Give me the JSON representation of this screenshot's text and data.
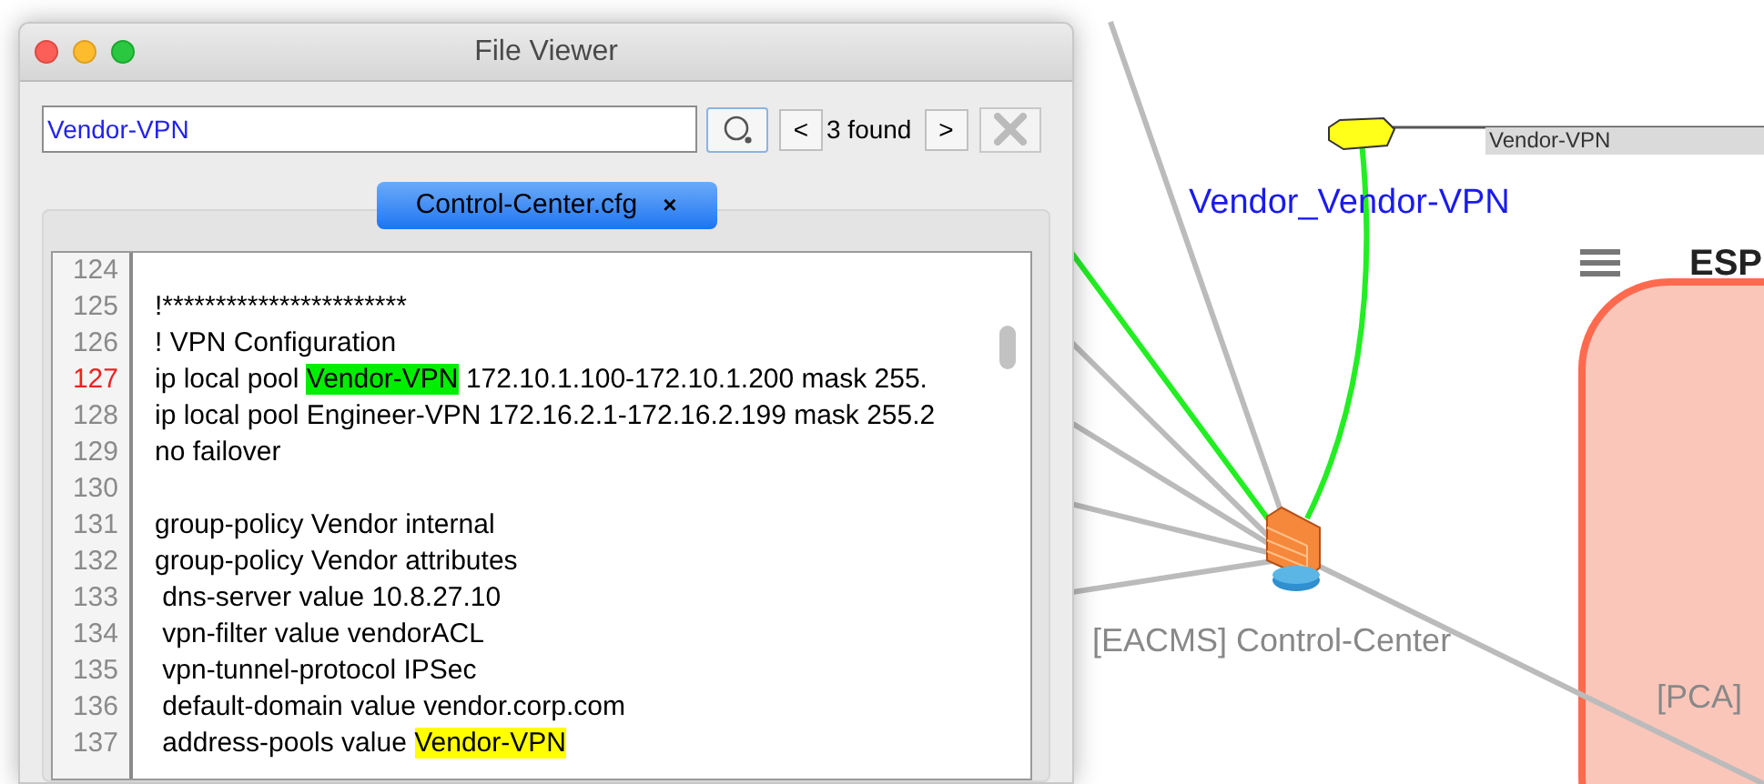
{
  "window": {
    "title": "File Viewer"
  },
  "search": {
    "value": "Vendor-VPN",
    "previous": "<",
    "result": "3 found",
    "next": ">"
  },
  "tabs": [
    {
      "label": "Control-Center.cfg",
      "close": "×",
      "selected": true
    }
  ],
  "editor": {
    "lines": [
      {
        "number": "124",
        "current": false
      },
      {
        "number": "125",
        "current": false,
        "parts": [
          {
            "text": "!***********************",
            "kind": "plain"
          }
        ]
      },
      {
        "number": "126",
        "current": false,
        "parts": [
          {
            "text": "! VPN Configuration",
            "kind": "plain"
          }
        ]
      },
      {
        "number": "127",
        "current": true,
        "parts": [
          {
            "text": "ip local pool ",
            "kind": "plain"
          },
          {
            "text": "Vendor-VPN",
            "kind": "current"
          },
          {
            "text": " 172.10.1.100-172.10.1.200 mask 255.",
            "kind": "plain"
          }
        ]
      },
      {
        "number": "128",
        "current": false,
        "parts": [
          {
            "text": "ip local pool Engineer-VPN 172.16.2.1-172.16.2.199 mask 255.2",
            "kind": "plain"
          }
        ]
      },
      {
        "number": "129",
        "current": false,
        "parts": [
          {
            "text": "no failover",
            "kind": "plain"
          }
        ]
      },
      {
        "number": "130",
        "current": false
      },
      {
        "number": "131",
        "current": false,
        "parts": [
          {
            "text": "group-policy Vendor internal",
            "kind": "plain"
          }
        ]
      },
      {
        "number": "132",
        "current": false,
        "parts": [
          {
            "text": "group-policy Vendor attributes",
            "kind": "plain"
          }
        ]
      },
      {
        "number": "133",
        "current": false,
        "parts": [
          {
            "text": " dns-server value 10.8.27.10",
            "kind": "plain"
          }
        ]
      },
      {
        "number": "134",
        "current": false,
        "parts": [
          {
            "text": " vpn-filter value vendorACL",
            "kind": "plain"
          }
        ]
      },
      {
        "number": "135",
        "current": false,
        "parts": [
          {
            "text": " vpn-tunnel-protocol IPSec",
            "kind": "plain"
          }
        ]
      },
      {
        "number": "136",
        "current": false,
        "parts": [
          {
            "text": " default-domain value vendor.corp.com",
            "kind": "plain"
          }
        ]
      },
      {
        "number": "137",
        "current": false,
        "parts": [
          {
            "text": " address-pools value ",
            "kind": "plain"
          },
          {
            "text": "Vendor-VPN",
            "kind": "match"
          }
        ]
      }
    ]
  },
  "diagram": {
    "links": [
      {
        "highlighted": false
      },
      {
        "highlighted": true
      },
      {
        "highlighted": false
      },
      {
        "highlighted": false
      },
      {
        "highlighted": false
      },
      {
        "highlighted": false
      },
      {
        "highlighted": true
      },
      {
        "highlighted": false
      }
    ],
    "cloud_label": "Vendor-VPN",
    "link_label": "Vendor_Vendor-VPN",
    "zone_title": "ESP",
    "device_label": "[EACMS] Control-Center",
    "zone_label": "[PCA]"
  }
}
